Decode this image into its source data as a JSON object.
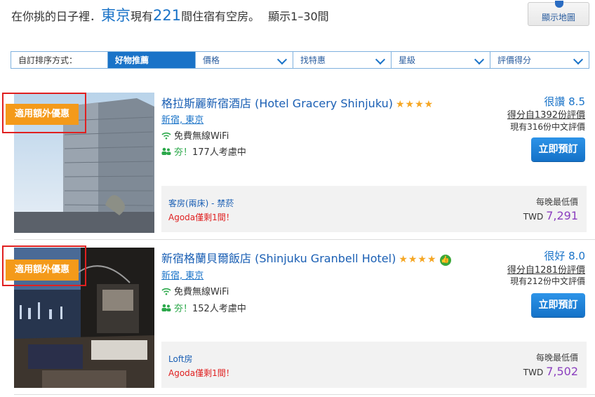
{
  "header": {
    "prefix": "在你挑的日子裡．",
    "city": "東京",
    "mid": "現有",
    "count": "221",
    "suffix": "間住宿有空房。",
    "showing": "顯示1–30間"
  },
  "map_button": {
    "label": "顯示地圖",
    "icon": "map-pin-icon"
  },
  "sort": {
    "label": "自訂排序方式：",
    "options": [
      "好物推薦",
      "價格",
      "找特惠",
      "星級",
      "評價得分"
    ],
    "active": "好物推薦"
  },
  "hotels": [
    {
      "badge": "適用額外優惠",
      "name": "格拉斯麗新宿酒店 (Hotel Gracery Shinjuku)",
      "stars": 4,
      "area": "新宿, 東京",
      "wifi": "免費無線WiFi",
      "popular_excl": "夯！",
      "popular": "177人考慮中",
      "rating": "很讚 8.5",
      "reviews": "得分自1392份評價",
      "cn_reviews": "現有316份中文評價",
      "book": "立即預訂",
      "room": "客房(兩床) - 禁菸",
      "rooms_left": "Agoda僅剩1間！",
      "price_label": "每晚最低價",
      "currency": "TWD",
      "price": "7,291",
      "colors": {
        "price": "#8b3fbf",
        "badge": "#f49a1a"
      }
    },
    {
      "badge": "適用額外優惠",
      "name": "新宿格蘭貝爾飯店 (Shinjuku Granbell Hotel)",
      "stars": 4,
      "thumbs_icon": "thumbs-up-icon",
      "area": "新宿, 東京",
      "wifi": "免費無線WiFi",
      "popular_excl": "夯！",
      "popular": "152人考慮中",
      "rating": "很好 8.0",
      "reviews": "得分自1281份評價",
      "cn_reviews": "現有212份中文評價",
      "book": "立即預訂",
      "room": "Loft房",
      "rooms_left": "Agoda僅剩1間！",
      "price_label": "每晚最低價",
      "currency": "TWD",
      "price": "7,502",
      "colors": {
        "price": "#8b3fbf",
        "badge": "#f49a1a"
      }
    }
  ]
}
